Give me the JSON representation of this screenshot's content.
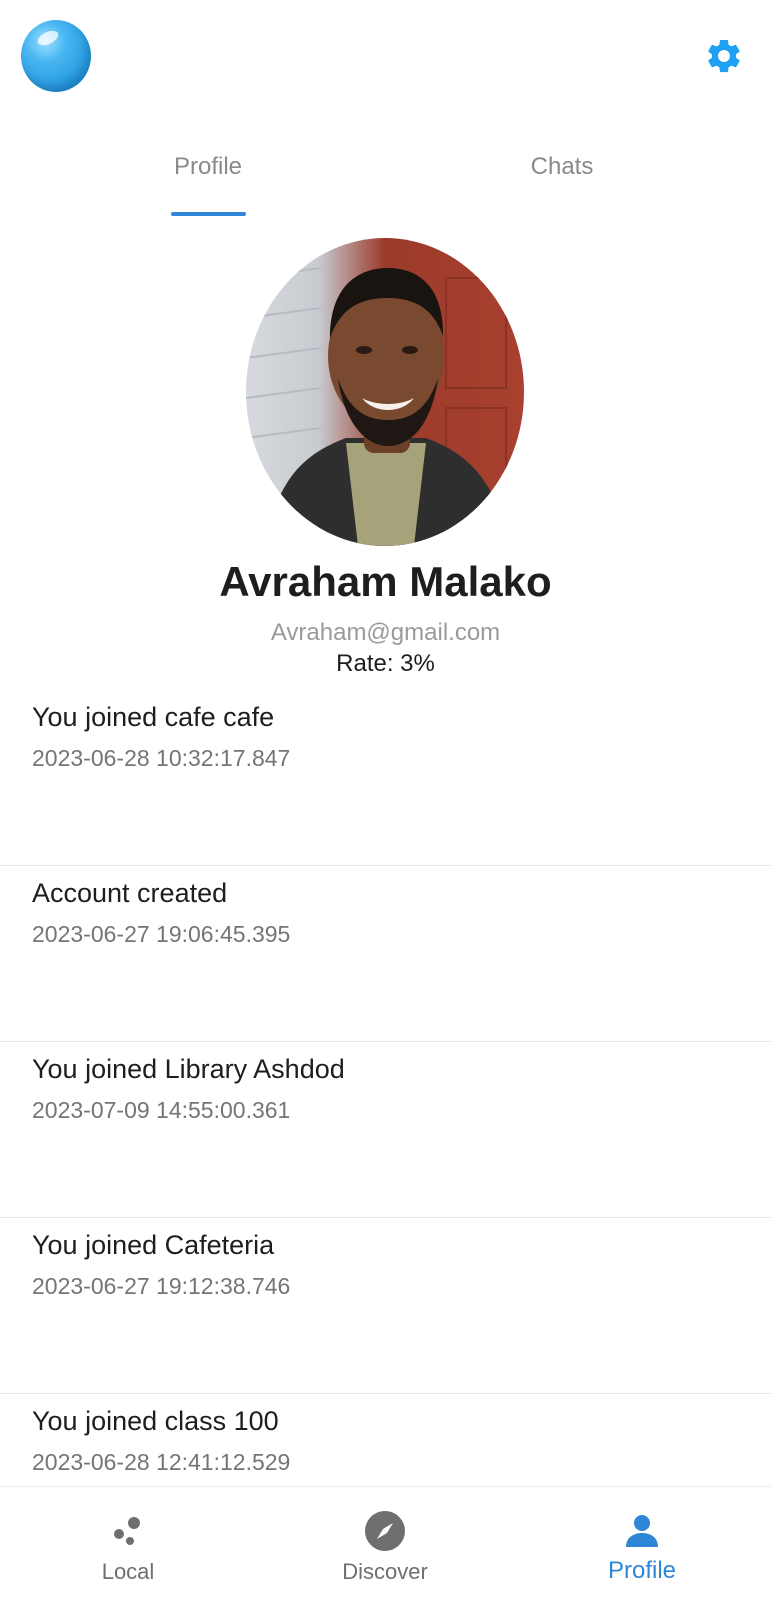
{
  "header": {
    "logo_icon": "blue-sphere-logo",
    "settings_icon": "gear-icon",
    "accent_color": "#1da1f2"
  },
  "tabs": [
    {
      "label": "Profile",
      "selected": true
    },
    {
      "label": "Chats",
      "selected": false
    }
  ],
  "profile": {
    "avatar": "user-photo",
    "name": "Avraham Malako",
    "email": "Avraham@gmail.com",
    "rate": "Rate: 3%"
  },
  "activities": [
    {
      "title": "You joined cafe cafe",
      "time": "2023-06-28 10:32:17.847"
    },
    {
      "title": "Account created",
      "time": "2023-06-27 19:06:45.395"
    },
    {
      "title": "You joined Library Ashdod",
      "time": "2023-07-09 14:55:00.361"
    },
    {
      "title": "You joined Cafeteria",
      "time": "2023-06-27 19:12:38.746"
    },
    {
      "title": "You joined class 100",
      "time": "2023-06-28 12:41:12.529"
    }
  ],
  "bottom_nav": {
    "items": [
      {
        "label": "Local",
        "icon": "dots-icon",
        "active": false
      },
      {
        "label": "Discover",
        "icon": "compass-icon",
        "active": false
      },
      {
        "label": "Profile",
        "icon": "person-icon",
        "active": true
      }
    ],
    "active_color": "#2f86d6"
  }
}
